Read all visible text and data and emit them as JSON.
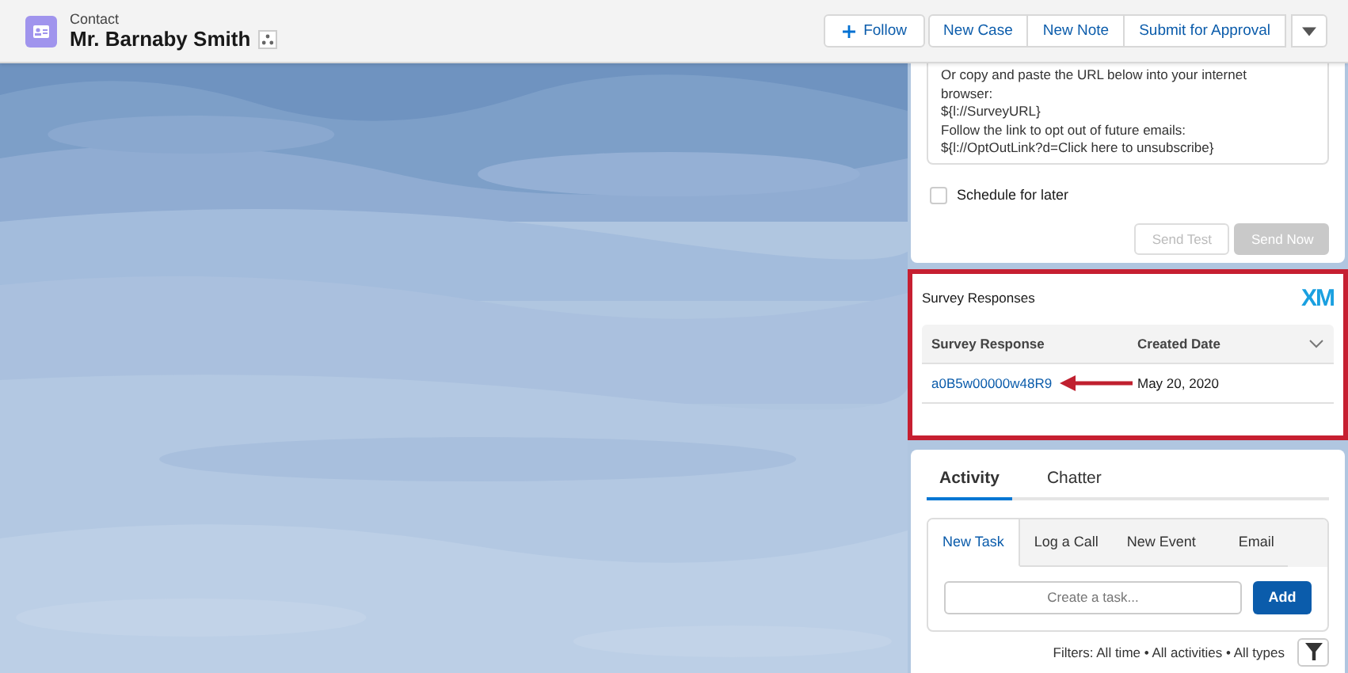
{
  "header": {
    "object_type": "Contact",
    "record_name": "Mr. Barnaby Smith",
    "actions": [
      {
        "label": "Follow",
        "kind": "follow"
      },
      {
        "label": "New Case",
        "kind": "plain"
      },
      {
        "label": "New Note",
        "kind": "plain"
      },
      {
        "label": "Submit for Approval",
        "kind": "plain"
      }
    ]
  },
  "email_card": {
    "message_lines": [
      "Or copy and paste the URL below into your internet",
      "browser:",
      "${l://SurveyURL}",
      "Follow the link to opt out of future emails:",
      "${l://OptOutLink?d=Click here to unsubscribe}"
    ],
    "schedule": {
      "label": "Schedule for later",
      "checked": false
    },
    "buttons": [
      {
        "label": "Send Test",
        "disabled": true,
        "kind": "outline"
      },
      {
        "label": "Send Now",
        "disabled": true,
        "kind": "brand"
      }
    ]
  },
  "survey_responses": {
    "title": "Survey Responses",
    "logo": "XM",
    "columns": [
      "Survey Response",
      "Created Date"
    ],
    "rows": [
      {
        "response": "a0B5w00000w48R9",
        "created": "May 20, 2020"
      }
    ]
  },
  "activity": {
    "tabs": [
      {
        "label": "Activity",
        "selected": true
      },
      {
        "label": "Chatter",
        "selected": false
      }
    ],
    "subtabs": [
      {
        "label": "New Task",
        "selected": true
      },
      {
        "label": "Log a Call",
        "selected": false
      },
      {
        "label": "New Event",
        "selected": false
      },
      {
        "label": "Email",
        "selected": false
      }
    ],
    "task_placeholder": "Create a task...",
    "add_button": "Add",
    "filters": "Filters: All time • All activities • All types"
  }
}
